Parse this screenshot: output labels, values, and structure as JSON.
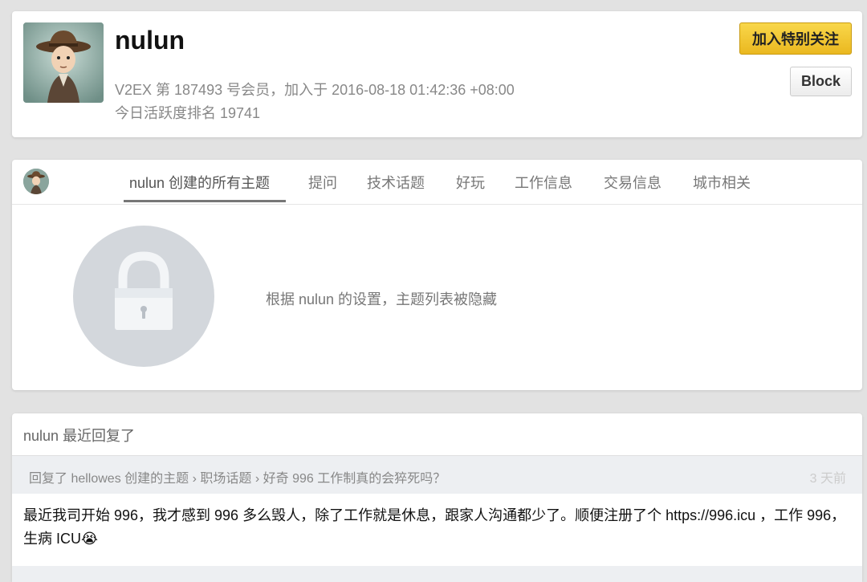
{
  "profile": {
    "username": "nulun",
    "member_info": "V2EX 第 187493 号会员，加入于 2016-08-18 01:42:36 +08:00",
    "activity_rank": "今日活跃度排名 19741",
    "follow_button": "加入特别关注",
    "block_button": "Block"
  },
  "topics": {
    "tabs": [
      {
        "label": "nulun 创建的所有主题"
      },
      {
        "label": "提问"
      },
      {
        "label": "技术话题"
      },
      {
        "label": "好玩"
      },
      {
        "label": "工作信息"
      },
      {
        "label": "交易信息"
      },
      {
        "label": "城市相关"
      }
    ],
    "hidden_message": "根据 nulun 的设置，主题列表被隐藏"
  },
  "replies": {
    "title": "nulun 最近回复了",
    "item": {
      "prefix": "回复了 hellowes 创建的主题",
      "sep": "›",
      "node": "职场话题",
      "topic": "好奇 996 工作制真的会猝死吗？",
      "time": "3 天前",
      "body": "最近我司开始 996，我才感到 996 多么毁人，除了工作就是休息，跟家人沟通都少了。顺便注册了个 https://996.icu ，工作 996，生病 ICU😭"
    }
  },
  "colors": {
    "follow_button": "#f1c232",
    "page_background": "#e2e2e2",
    "reply_header": "#edeff2"
  }
}
